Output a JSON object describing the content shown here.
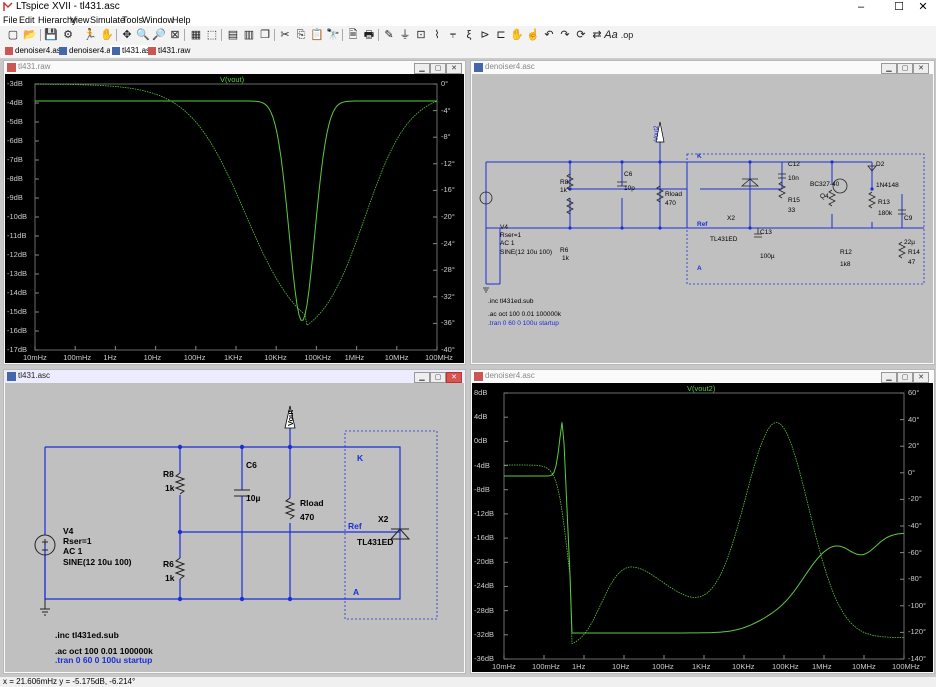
{
  "app": {
    "title": "LTspice XVII - tl431.asc"
  },
  "menu": [
    "File",
    "Edit",
    "Hierarchy",
    "View",
    "Simulate",
    "Tools",
    "Window",
    "Help"
  ],
  "tabs": [
    {
      "label": "denoiser4.asc",
      "active": false
    },
    {
      "label": "denoiser4.asc",
      "active": false
    },
    {
      "label": "tl431.asc",
      "active": true
    },
    {
      "label": "tl431.raw",
      "active": false
    }
  ],
  "windows": {
    "w1": {
      "title": "tl431.raw"
    },
    "w2": {
      "title": "denoiser4.asc"
    },
    "w3": {
      "title": "tl431.asc"
    },
    "w4": {
      "title": "denoiser4.asc"
    }
  },
  "plot1": {
    "trace_label": "V(vout)",
    "y_left": [
      "-3dB",
      "-4dB",
      "-5dB",
      "-6dB",
      "-7dB",
      "-8dB",
      "-9dB",
      "-10dB",
      "-11dB",
      "-12dB",
      "-13dB",
      "-14dB",
      "-15dB",
      "-16dB",
      "-17dB"
    ],
    "y_right": [
      "0°",
      "-4°",
      "-8°",
      "-12°",
      "-16°",
      "-20°",
      "-24°",
      "-28°",
      "-32°",
      "-36°",
      "-40°"
    ],
    "x": [
      "10mHz",
      "100mHz",
      "1Hz",
      "10Hz",
      "100Hz",
      "1KHz",
      "10KHz",
      "100KHz",
      "1MHz",
      "10MHz",
      "100MHz"
    ]
  },
  "plot2": {
    "trace_label": "V(vout2)",
    "y_left": [
      "8dB",
      "4dB",
      "0dB",
      "-4dB",
      "-8dB",
      "-12dB",
      "-16dB",
      "-20dB",
      "-24dB",
      "-28dB",
      "-32dB",
      "-36dB"
    ],
    "y_right": [
      "60°",
      "40°",
      "20°",
      "0°",
      "-20°",
      "-40°",
      "-60°",
      "-80°",
      "-100°",
      "-120°",
      "-140°"
    ],
    "x": [
      "10mHz",
      "100mHz",
      "1Hz",
      "10Hz",
      "100Hz",
      "1KHz",
      "10KHz",
      "100KHz",
      "1MHz",
      "10MHz",
      "100MHz"
    ]
  },
  "schem_small": {
    "vout": "Vout2",
    "K": "K",
    "A": "A",
    "Ref": "Ref",
    "R8": "R8",
    "R8v": "1k",
    "C6": "C6",
    "C6v": "10p",
    "Rload": "Rload",
    "Rloadv": "470",
    "R6": "R6",
    "R6v": "1k",
    "X2": "X2",
    "X2v": "TL431ED",
    "C13": "C13",
    "C13v": "100µ",
    "C12": "C12",
    "C12v": "10n",
    "R15": "R15",
    "R15v": "33",
    "Q4v": "BC327-40",
    "Q4": "Q4",
    "D2": "D2",
    "D2v": "1N4148",
    "R13": "R13",
    "R13v": "180k",
    "C9": "C9",
    "C9v": "22µ",
    "R12": "R12",
    "R12v": "1k8",
    "R14": "R14",
    "R14v": "47",
    "V4": "V4",
    "V4a": "Rser=1",
    "V4b": "AC 1",
    "V4c": "SINE(12 10u 100)",
    "inc": ".inc tl431ed.sub",
    "ac": ".ac oct 100 0.01 100000k",
    "tran": ".tran 0 60 0 100u startup"
  },
  "schem_big": {
    "vout": "Vout",
    "K": "K",
    "A": "A",
    "Ref": "Ref",
    "R8": "R8",
    "R8v": "1k",
    "C6": "C6",
    "C6v": "10µ",
    "Rload": "Rload",
    "Rloadv": "470",
    "R6": "R6",
    "R6v": "1k",
    "X2": "X2",
    "X2v": "TL431ED",
    "V4": "V4",
    "V4a": "Rser=1",
    "V4b": "AC 1",
    "V4c": "SINE(12 10u 100)",
    "inc": ".inc tl431ed.sub",
    "ac": ".ac oct 100 0.01 100000k",
    "tran": ".tran 0 60 0 100u startup"
  },
  "status": {
    "text": "x = 21.606mHz   y = -5.175dB, -6.214°"
  },
  "colors": {
    "trace": "#5ecb3f",
    "wire": "#1a2fd6",
    "plot_bg": "#000000",
    "schem_bg": "#c0c0c0",
    "directive": "#1a2fd6"
  }
}
